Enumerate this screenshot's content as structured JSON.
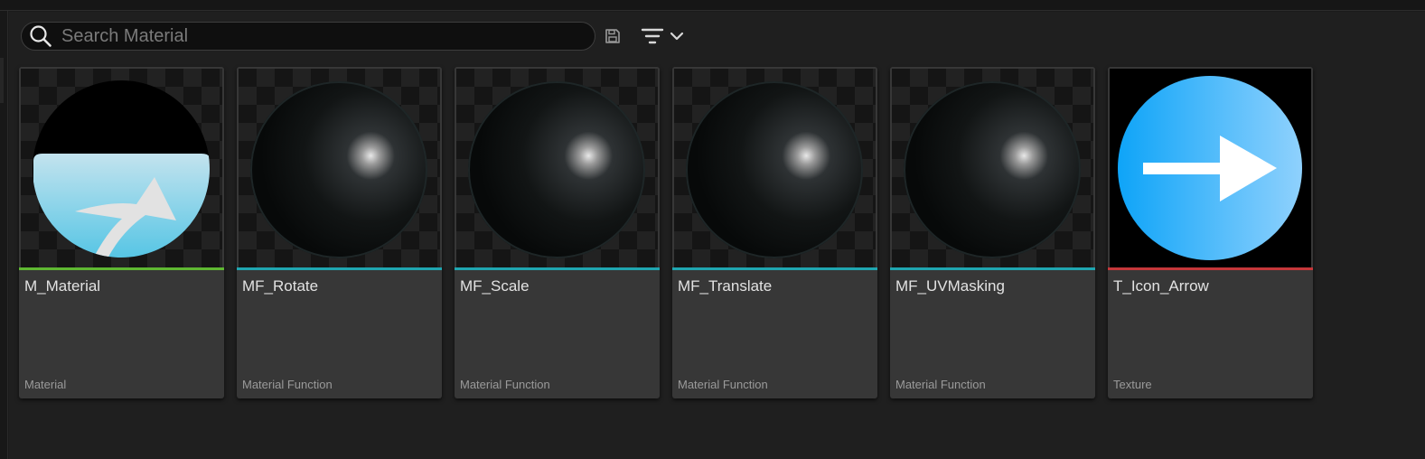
{
  "search": {
    "placeholder": "Search Material",
    "value": ""
  },
  "toolbar": {
    "save_icon": "save-icon",
    "filter_icon": "filter-icon",
    "dropdown_icon": "chevron-down-icon"
  },
  "colors": {
    "material": "#5fb832",
    "material_function": "#1fa6b0",
    "texture": "#c5373a"
  },
  "assets": [
    {
      "name": "M_Material",
      "type": "Material",
      "thumbnail": "material-sphere-icon"
    },
    {
      "name": "MF_Rotate",
      "type": "Material Function",
      "thumbnail": "dark-sphere-icon"
    },
    {
      "name": "MF_Scale",
      "type": "Material Function",
      "thumbnail": "dark-sphere-icon"
    },
    {
      "name": "MF_Translate",
      "type": "Material Function",
      "thumbnail": "dark-sphere-icon"
    },
    {
      "name": "MF_UVMasking",
      "type": "Material Function",
      "thumbnail": "dark-sphere-icon"
    },
    {
      "name": "T_Icon_Arrow",
      "type": "Texture",
      "thumbnail": "arrow-icon"
    }
  ]
}
